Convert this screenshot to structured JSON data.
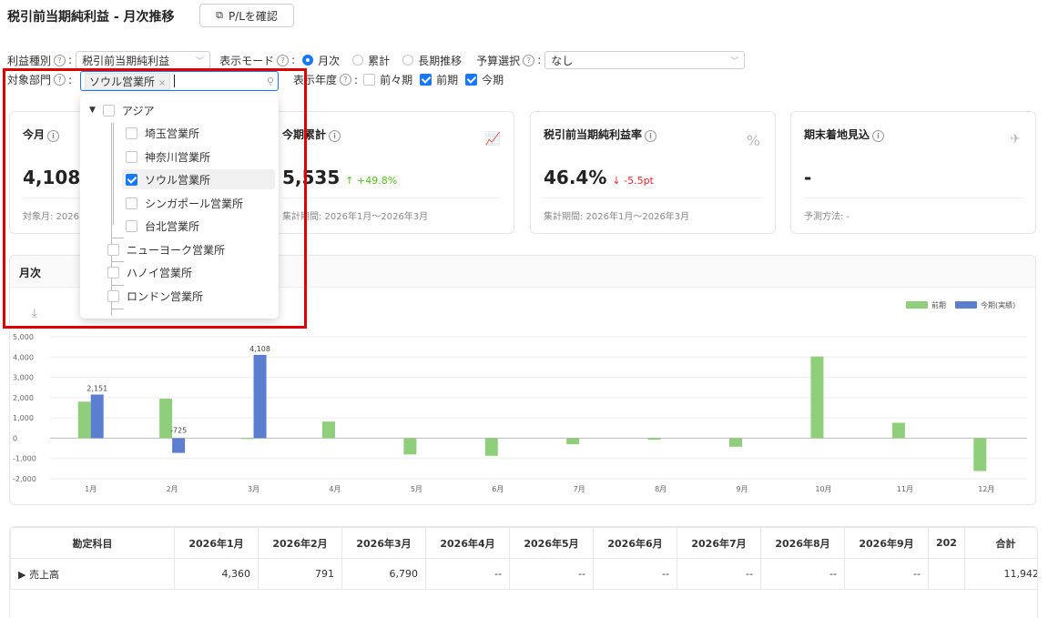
{
  "header": {
    "title": "税引前当期純利益 - 月次推移",
    "pl_button_label": "P/Lを確認"
  },
  "filters": {
    "profit_type_label": "利益種別",
    "profit_type_value": "税引前当期純利益",
    "display_mode_label": "表示モード",
    "mode_options": [
      "月次",
      "累計",
      "長期推移"
    ],
    "budget_label": "予算選択",
    "budget_value": "なし",
    "dept_label": "対象部門",
    "dept_tag": "ソウル営業所",
    "year_label": "表示年度",
    "year_options": [
      "前々期",
      "前期",
      "今期"
    ]
  },
  "dropdown": {
    "root": "アジア",
    "children": [
      "埼玉営業所",
      "神奈川営業所",
      "ソウル営業所",
      "シンガポール営業所",
      "台北営業所"
    ],
    "others": [
      "ニューヨーク営業所",
      "ハノイ営業所",
      "ロンドン営業所"
    ]
  },
  "cards": [
    {
      "title": "今月",
      "value": "4,108",
      "delta": "",
      "footer": "対象月: 2026"
    },
    {
      "title": "今期累計",
      "value": "5,535",
      "delta": "↑ +49.8%",
      "footer": "集計期間: 2026年1月〜2026年3月"
    },
    {
      "title": "税引前当期純利益率",
      "value": "46.4%",
      "delta": "↓ -5.5pt",
      "footer": "集計期間: 2026年1月〜2026年3月"
    },
    {
      "title": "期末着地見込",
      "value": "-",
      "delta": "",
      "footer": "予測方法: -"
    }
  ],
  "chart_panel": {
    "tab_label": "月次"
  },
  "chart_data": {
    "type": "bar",
    "categories": [
      "1月",
      "2月",
      "3月",
      "4月",
      "5月",
      "6月",
      "7月",
      "8月",
      "9月",
      "10月",
      "11月",
      "12月"
    ],
    "series": [
      {
        "name": "前期",
        "values": [
          1800,
          1950,
          -20,
          820,
          -800,
          -870,
          -300,
          -80,
          -420,
          4030,
          760,
          -1620
        ],
        "color": "#8fcf7b"
      },
      {
        "name": "今期(実績)",
        "values": [
          2151,
          -725,
          4108,
          null,
          null,
          null,
          null,
          null,
          null,
          null,
          null,
          null
        ],
        "color": "#5b7ed0"
      }
    ],
    "data_labels": [
      "2,151",
      "-725",
      "4,108"
    ],
    "yticks": [
      "5,000",
      "4,000",
      "3,000",
      "2,000",
      "1,000",
      "0",
      "-1,000",
      "-2,000"
    ],
    "ylim": [
      -2000,
      5000
    ],
    "legend_position": "top-right"
  },
  "table": {
    "headers": [
      "勘定科目",
      "2026年1月",
      "2026年2月",
      "2026年3月",
      "2026年4月",
      "2026年5月",
      "2026年6月",
      "2026年7月",
      "2026年8月",
      "2026年9月",
      "202",
      "合計"
    ],
    "rows": [
      {
        "label": "売上高",
        "values": [
          "4,360",
          "791",
          "6,790",
          "--",
          "--",
          "--",
          "--",
          "--",
          "--",
          "",
          "11,942"
        ]
      }
    ]
  },
  "colors": {
    "accent": "#1677ff",
    "highlight": "#e00000",
    "prev": "#8fcf7b",
    "curr": "#5b7ed0"
  }
}
